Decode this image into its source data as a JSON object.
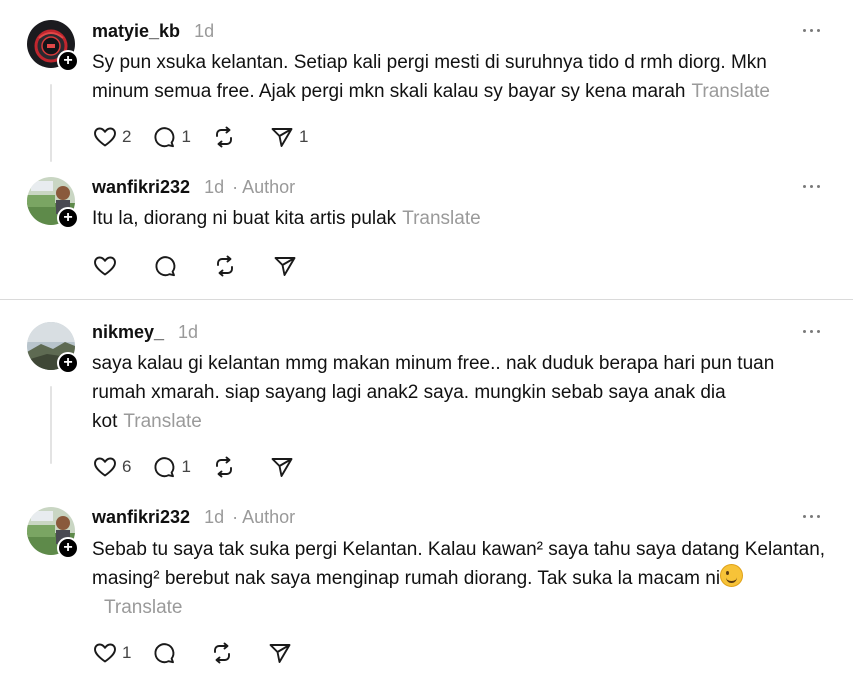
{
  "comments": [
    {
      "username": "matyie_kb",
      "time": "1d",
      "author": "",
      "text": "Sy pun xsuka kelantan. Setiap kali pergi mesti di suruhnya tido d rmh diorg. Mkn minum semua free. Ajak pergi mkn skali kalau sy bayar sy kena marah",
      "translate": "Translate",
      "likes": "2",
      "replies": "1",
      "reposts": "",
      "shares": "1"
    },
    {
      "username": "wanfikri232",
      "time": "1d",
      "author": "· Author",
      "text": "Itu la, diorang ni buat kita artis pulak",
      "translate": "Translate",
      "likes": "",
      "replies": "",
      "reposts": "",
      "shares": ""
    },
    {
      "username": "nikmey_",
      "time": "1d",
      "author": "",
      "text": "saya kalau gi kelantan mmg makan minum free.. nak duduk berapa hari pun tuan rumah xmarah. siap sayang lagi anak2 saya. mungkin sebab saya anak dia kot",
      "translate": "Translate",
      "likes": "6",
      "replies": "1",
      "reposts": "",
      "shares": ""
    },
    {
      "username": "wanfikri232",
      "time": "1d",
      "author": "· Author",
      "text": "Sebab tu saya tak suka pergi Kelantan. Kalau kawan² saya tahu saya datang Kelantan, masing² berebut nak saya menginap rumah diorang. Tak suka la macam ni",
      "emoji": "winking-face",
      "translate": "Translate",
      "likes": "1",
      "replies": "",
      "reposts": "",
      "shares": ""
    }
  ],
  "colors": {
    "text": "#101010",
    "muted": "#9a9a9a",
    "divider": "#dadada",
    "thread_line": "#e3e3e3"
  }
}
